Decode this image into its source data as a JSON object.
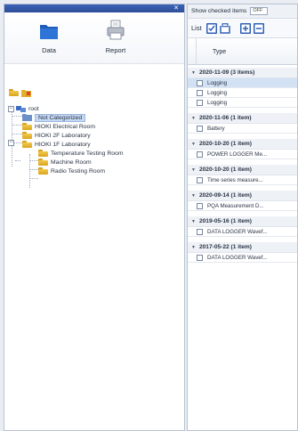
{
  "left_pane": {
    "pin_glyph": "✕",
    "toolbar": {
      "data_label": "Data",
      "report_label": "Report"
    },
    "tree": {
      "root": "root",
      "items": [
        {
          "label": "Not Categorized",
          "selected": true
        },
        {
          "label": "HIOKI Electrical Room"
        },
        {
          "label": "HIOKI 2F Laboratory"
        },
        {
          "label": "HIOKI 1F Laboratory"
        },
        {
          "label": "Temperature Testing Room"
        },
        {
          "label": "Machine Room"
        },
        {
          "label": "Radio Testing Room"
        }
      ]
    }
  },
  "right_pane": {
    "show_checked_label": "Show checked items",
    "show_checked_value": "OFF",
    "list_label": "List",
    "column_type": "Type",
    "groups": [
      {
        "date": "2020-11-09 (3 items)",
        "items": [
          "Logging",
          "Logging",
          "Logging"
        ]
      },
      {
        "date": "2020-11-06 (1 item)",
        "items": [
          "Battery"
        ]
      },
      {
        "date": "2020-10-20 (1 item)",
        "items": [
          "POWER LOGGER Me..."
        ]
      },
      {
        "date": "2020-10-20 (1 item)",
        "items": [
          "Time series measure..."
        ]
      },
      {
        "date": "2020-09-14 (1 item)",
        "items": [
          "PQA Measurement D..."
        ]
      },
      {
        "date": "2019-05-16 (1 item)",
        "items": [
          "DATA LOGGER Wavef..."
        ]
      },
      {
        "date": "2017-05-22 (1 item)",
        "items": [
          "DATA LOGGER Wavef..."
        ]
      }
    ]
  },
  "colors": {
    "accent": "#2f5fb8",
    "folder": "#f3c94c",
    "selection": "#c6d9f3"
  }
}
